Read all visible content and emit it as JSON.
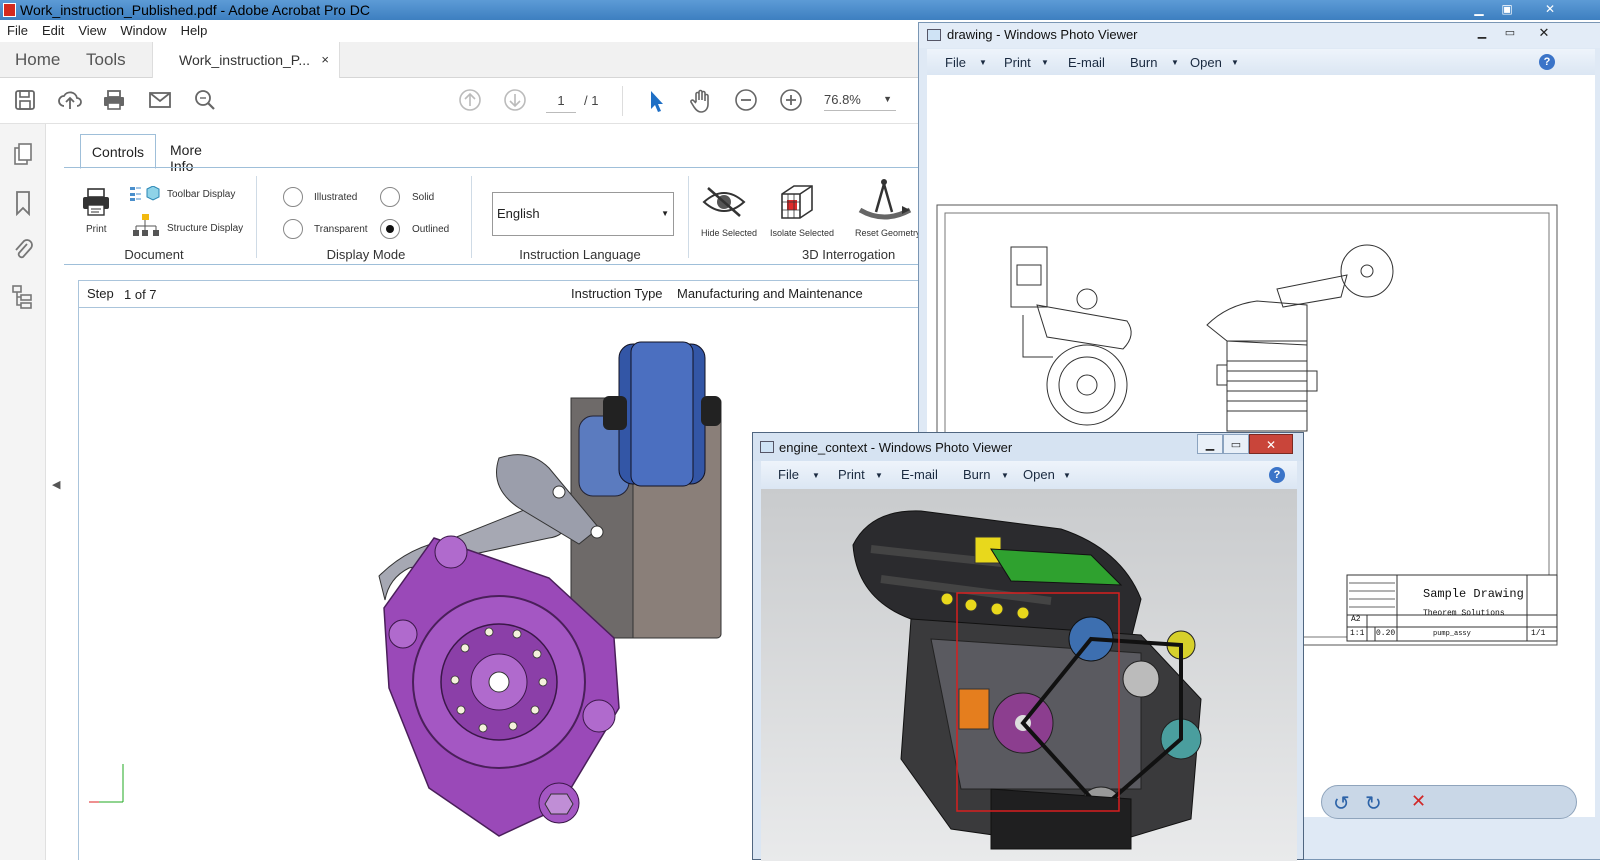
{
  "acrobat": {
    "window_title": "Work_instruction_Published.pdf - Adobe Acrobat Pro DC",
    "menu": [
      "File",
      "Edit",
      "View",
      "Window",
      "Help"
    ],
    "tabs": {
      "home": "Home",
      "tools": "Tools",
      "document": "Work_instruction_P...",
      "close": "×"
    },
    "page_current": "1",
    "page_total": "/ 1",
    "zoom": "76.8%"
  },
  "controls": {
    "tab_controls": "Controls",
    "tab_more_info": "More Info",
    "print": "Print",
    "toolbar_display": "Toolbar Display",
    "structure_display": "Structure Display",
    "group_document": "Document",
    "illustrated": "Illustrated",
    "solid": "Solid",
    "transparent": "Transparent",
    "outlined": "Outlined",
    "group_display_mode": "Display Mode",
    "language_value": "English",
    "group_language": "Instruction Language",
    "hide_selected": "Hide Selected",
    "isolate_selected": "Isolate Selected",
    "reset_geometry": "Reset Geometry",
    "group_interrogation": "3D Interrogation",
    "display_mode_selected": "Outlined"
  },
  "step": {
    "label": "Step",
    "value": "1 of 7",
    "type_label": "Instruction Type",
    "type_value": "Manufacturing and Maintenance"
  },
  "drawing_viewer": {
    "title": "drawing - Windows Photo Viewer",
    "menu": {
      "file": "File",
      "print": "Print",
      "email": "E-mail",
      "burn": "Burn",
      "open": "Open"
    },
    "title_block": {
      "name": "Sample Drawing",
      "company": "Theorem Solutions",
      "size": "A2",
      "scale": "1:1",
      "weight": "0.20",
      "part": "pump_assy",
      "sheet": "1/1"
    }
  },
  "engine_viewer": {
    "title": "engine_context - Windows Photo Viewer",
    "menu": {
      "file": "File",
      "print": "Print",
      "email": "E-mail",
      "burn": "Burn",
      "open": "Open"
    }
  }
}
